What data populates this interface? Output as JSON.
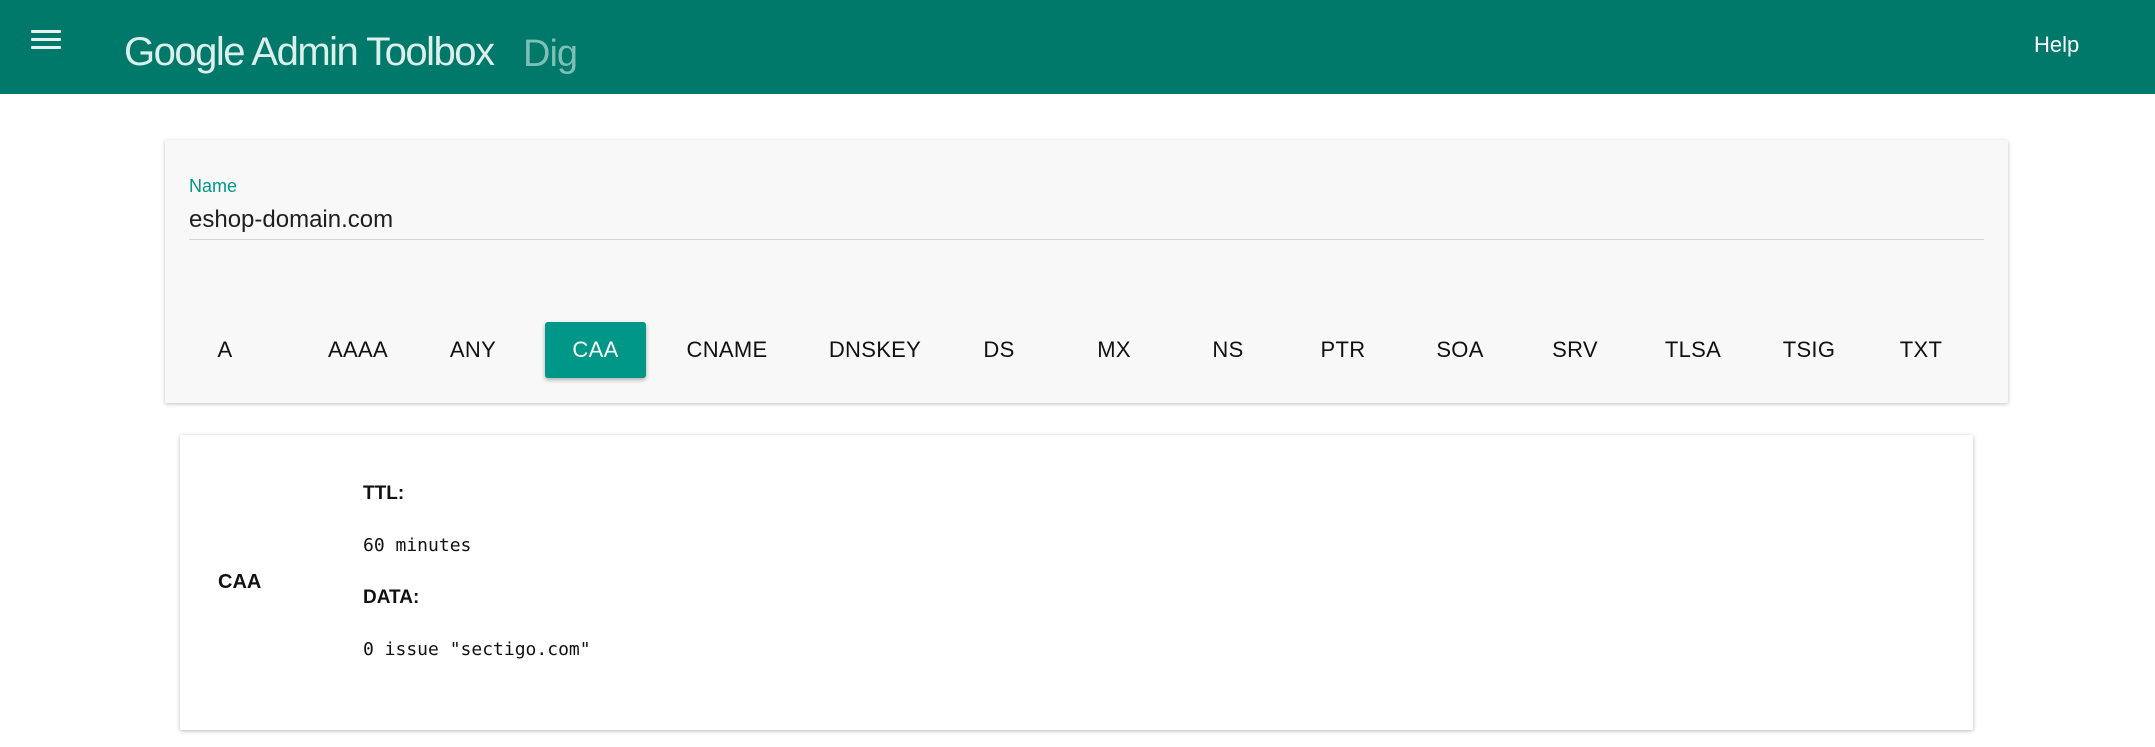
{
  "header": {
    "title": "Google Admin Toolbox",
    "subtitle": "Dig",
    "menu_icon": "hamburger-menu-icon",
    "help_label": "Help",
    "background_color": "#00796b"
  },
  "query": {
    "name_label": "Name",
    "name_value": "eshop-domain.com",
    "record_types": [
      "A",
      "AAAA",
      "ANY",
      "CAA",
      "CNAME",
      "DNSKEY",
      "DS",
      "MX",
      "NS",
      "PTR",
      "SOA",
      "SRV",
      "TLSA",
      "TSIG",
      "TXT"
    ],
    "selected_type": "CAA",
    "accent_color": "#009688"
  },
  "result": {
    "record_type": "CAA",
    "ttl_label": "TTL:",
    "ttl_value": "60 minutes",
    "data_label": "DATA:",
    "data_value": "0 issue \"sectigo.com\""
  }
}
